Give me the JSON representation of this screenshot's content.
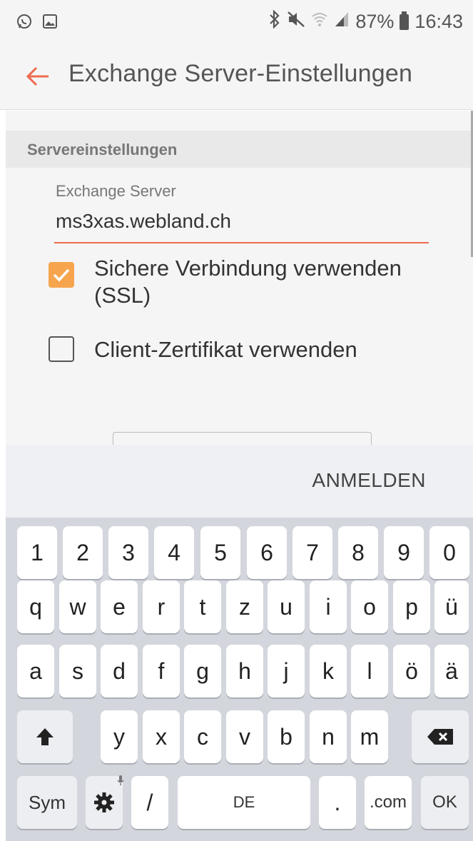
{
  "status_bar": {
    "battery": "87%",
    "time": "16:43",
    "left_icons": [
      "whatsapp-icon",
      "image-icon"
    ],
    "right_icons": [
      "bluetooth-icon",
      "mute-icon",
      "wifi-icon",
      "signal-icon",
      "battery-icon"
    ]
  },
  "app_bar": {
    "title": "Exchange Server-Einstellungen",
    "back_icon": "arrow-left-icon"
  },
  "section": {
    "title": "Servereinstellungen"
  },
  "server_field": {
    "label": "Exchange Server",
    "value": "ms3xas.webland.ch"
  },
  "checkboxes": [
    {
      "label": "Sichere Verbindung verwenden (SSL)",
      "checked": true
    },
    {
      "label": "Client-Zertifikat verwenden",
      "checked": false
    }
  ],
  "action_strip": {
    "label": "ANMELDEN"
  },
  "keyboard": {
    "row_numbers": [
      "1",
      "2",
      "3",
      "4",
      "5",
      "6",
      "7",
      "8",
      "9",
      "0"
    ],
    "row1": [
      "q",
      "w",
      "e",
      "r",
      "t",
      "z",
      "u",
      "i",
      "o",
      "p",
      "ü"
    ],
    "row2": [
      "a",
      "s",
      "d",
      "f",
      "g",
      "h",
      "j",
      "k",
      "l",
      "ö",
      "ä"
    ],
    "row3": [
      "y",
      "x",
      "c",
      "v",
      "b",
      "n",
      "m"
    ],
    "bottom": {
      "sym": "Sym",
      "slash": "/",
      "space": "DE",
      "period": ".",
      "dotcom": ".com",
      "ok": "OK"
    },
    "accent_color": "#f6a54e",
    "underline_color": "#ee6a50"
  }
}
